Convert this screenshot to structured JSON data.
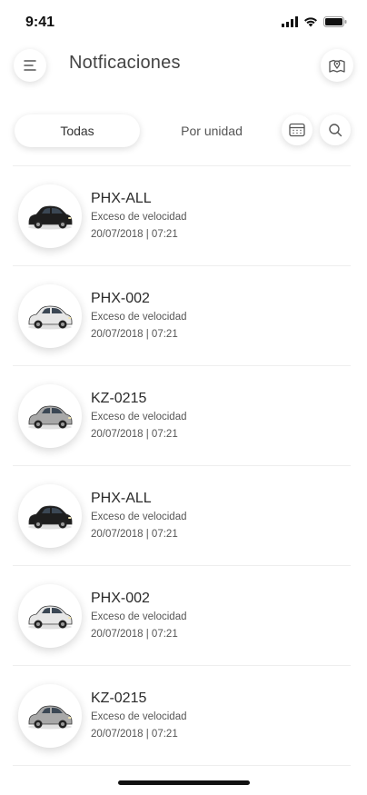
{
  "status": {
    "time": "9:41"
  },
  "header": {
    "title": "Notficaciones"
  },
  "filters": {
    "tab_all": "Todas",
    "tab_unit": "Por unidad"
  },
  "notifications": [
    {
      "unit": "PHX-ALL",
      "event": "Exceso de velocidad",
      "datetime": "20/07/2018 | 07:21",
      "car_color": "#1e1e1e"
    },
    {
      "unit": "PHX-002",
      "event": "Exceso de velocidad",
      "datetime": "20/07/2018 | 07:21",
      "car_color": "#e6e6e6"
    },
    {
      "unit": "KZ-0215",
      "event": "Exceso de velocidad",
      "datetime": "20/07/2018 | 07:21",
      "car_color": "#a8a8a8"
    },
    {
      "unit": "PHX-ALL",
      "event": "Exceso de velocidad",
      "datetime": "20/07/2018 | 07:21",
      "car_color": "#1e1e1e"
    },
    {
      "unit": "PHX-002",
      "event": "Exceso de velocidad",
      "datetime": "20/07/2018 | 07:21",
      "car_color": "#e6e6e6"
    },
    {
      "unit": "KZ-0215",
      "event": "Exceso de velocidad",
      "datetime": "20/07/2018 | 07:21",
      "car_color": "#a8a8a8"
    }
  ]
}
